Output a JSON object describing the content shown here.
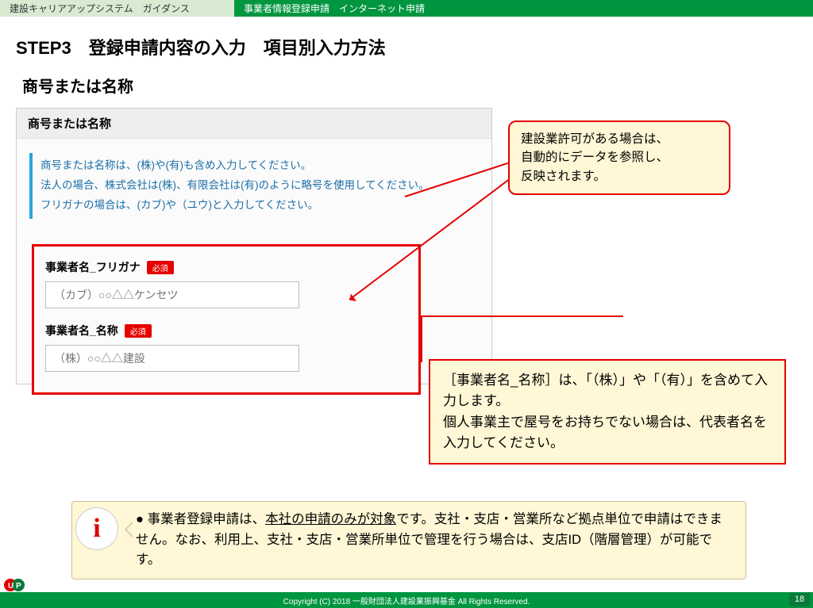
{
  "header": {
    "left": "建設キャリアアップシステム　ガイダンス",
    "right": "事業者情報登録申請　インターネット申請"
  },
  "titles": {
    "step": "STEP3　登録申請内容の入力　項目別入力方法",
    "sub": "商号または名称"
  },
  "panel": {
    "header": "商号または名称",
    "guide1": "商号または名称は、(株)や(有)も含め入力してください。",
    "guide2": "法人の場合、株式会社は(株)、有限会社は(有)のように略号を使用してください。",
    "guide3": "フリガナの場合は、(カブ)や（ユウ)と入力してください。"
  },
  "form": {
    "label_furigana": "事業者名_フリガナ",
    "label_name": "事業者名_名称",
    "required": "必須",
    "placeholder_furigana": "（カブ）○○△△ケンセツ",
    "placeholder_name": "（株）○○△△建設"
  },
  "callout1": {
    "l1": "建設業許可がある場合は、",
    "l2": "自動的にデータを参照し、",
    "l3": "反映されます。"
  },
  "callout2": {
    "l1": "［事業者名_名称］は、「（株）」や「（有）」を含めて入力します。",
    "l2": "個人事業主で屋号をお持ちでない場合は、代表者名を入力してください。"
  },
  "info": {
    "bullet": "●",
    "prefix": "事業者登録申請は、",
    "underline": "本社の申請のみが対象",
    "rest": "です。支社・支店・営業所など拠点単位で申請はできません。なお、利用上、支社・支店・営業所単位で管理を行う場合は、支店ID（階層管理）が可能です。"
  },
  "footer": {
    "copyright": "Copyright (C) 2018 一般財団法人建設業振興基金 All Rights Reserved.",
    "page": "18"
  }
}
